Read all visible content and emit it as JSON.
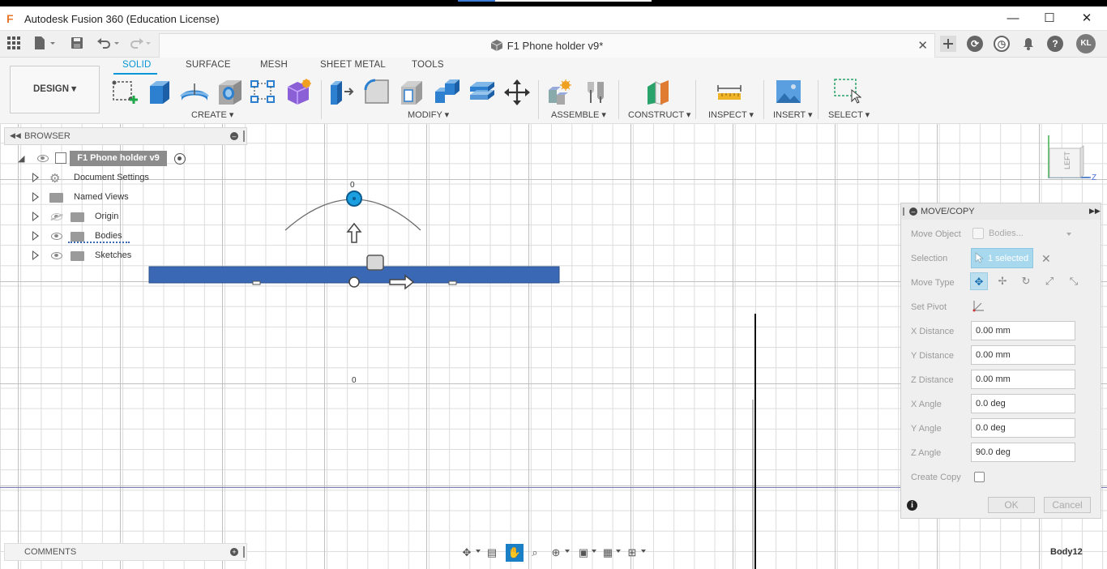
{
  "window": {
    "title": "Autodesk Fusion 360 (Education License)",
    "minimize": "—",
    "maximize": "☐",
    "close": "✕"
  },
  "document_tab": {
    "title": "F1 Phone holder v9*",
    "close": "✕"
  },
  "user_initials": "KL",
  "ribbon": {
    "tabs": [
      "SOLID",
      "SURFACE",
      "MESH",
      "SHEET METAL",
      "TOOLS"
    ],
    "active_tab": "SOLID",
    "workspace": "DESIGN ▾",
    "groups": {
      "create": "CREATE ▾",
      "modify": "MODIFY ▾",
      "assemble": "ASSEMBLE ▾",
      "construct": "CONSTRUCT ▾",
      "inspect": "INSPECT ▾",
      "insert": "INSERT ▾",
      "select": "SELECT ▾"
    }
  },
  "browser": {
    "title": "BROWSER",
    "root": "F1 Phone holder v9",
    "items": [
      {
        "label": "Document Settings",
        "icon": "gear-icon"
      },
      {
        "label": "Named Views",
        "icon": "folder-icon"
      },
      {
        "label": "Origin",
        "icon": "folder-icon"
      },
      {
        "label": "Bodies",
        "icon": "folder-icon"
      },
      {
        "label": "Sketches",
        "icon": "folder-icon"
      }
    ]
  },
  "comments": {
    "title": "COMMENTS"
  },
  "viewport": {
    "rotate_value": "0",
    "distance_value": "0",
    "view_cube_label": "LEFT",
    "axis_z": "Z",
    "status": "Body12"
  },
  "move_copy": {
    "title": "MOVE/COPY",
    "move_object_label": "Move Object",
    "move_object_value": "Bodies...",
    "selection_label": "Selection",
    "selection_value": "1 selected",
    "move_type_label": "Move Type",
    "set_pivot_label": "Set Pivot",
    "x_distance_label": "X Distance",
    "x_distance": "0.00 mm",
    "y_distance_label": "Y Distance",
    "y_distance": "0.00 mm",
    "z_distance_label": "Z Distance",
    "z_distance": "0.00 mm",
    "x_angle_label": "X Angle",
    "x_angle": "0.0 deg",
    "y_angle_label": "Y Angle",
    "y_angle": "0.0 deg",
    "z_angle_label": "Z Angle",
    "z_angle": "90.0 deg",
    "create_copy_label": "Create Copy",
    "ok": "OK",
    "cancel": "Cancel"
  },
  "colors": {
    "accent": "#0696d7",
    "body_fill": "#3a68b4",
    "selection_fill": "#a8d8ee"
  }
}
